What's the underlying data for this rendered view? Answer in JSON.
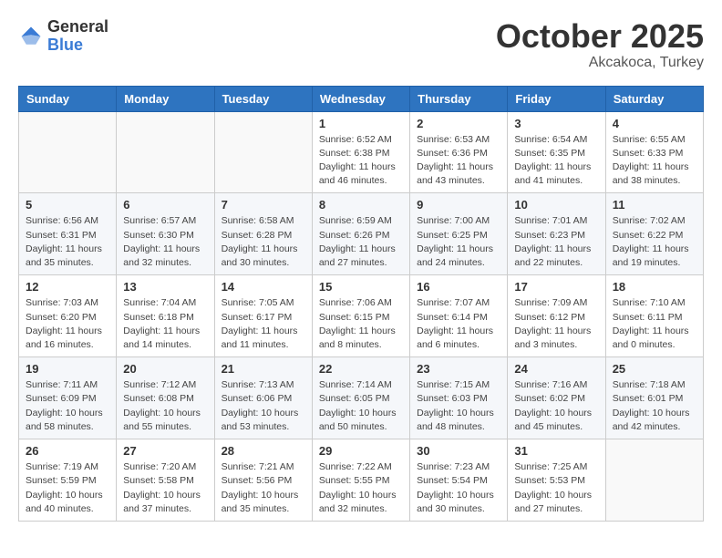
{
  "header": {
    "logo_general": "General",
    "logo_blue": "Blue",
    "month": "October 2025",
    "location": "Akcakoca, Turkey"
  },
  "weekdays": [
    "Sunday",
    "Monday",
    "Tuesday",
    "Wednesday",
    "Thursday",
    "Friday",
    "Saturday"
  ],
  "weeks": [
    [
      {
        "day": "",
        "info": ""
      },
      {
        "day": "",
        "info": ""
      },
      {
        "day": "",
        "info": ""
      },
      {
        "day": "1",
        "info": "Sunrise: 6:52 AM\nSunset: 6:38 PM\nDaylight: 11 hours and 46 minutes."
      },
      {
        "day": "2",
        "info": "Sunrise: 6:53 AM\nSunset: 6:36 PM\nDaylight: 11 hours and 43 minutes."
      },
      {
        "day": "3",
        "info": "Sunrise: 6:54 AM\nSunset: 6:35 PM\nDaylight: 11 hours and 41 minutes."
      },
      {
        "day": "4",
        "info": "Sunrise: 6:55 AM\nSunset: 6:33 PM\nDaylight: 11 hours and 38 minutes."
      }
    ],
    [
      {
        "day": "5",
        "info": "Sunrise: 6:56 AM\nSunset: 6:31 PM\nDaylight: 11 hours and 35 minutes."
      },
      {
        "day": "6",
        "info": "Sunrise: 6:57 AM\nSunset: 6:30 PM\nDaylight: 11 hours and 32 minutes."
      },
      {
        "day": "7",
        "info": "Sunrise: 6:58 AM\nSunset: 6:28 PM\nDaylight: 11 hours and 30 minutes."
      },
      {
        "day": "8",
        "info": "Sunrise: 6:59 AM\nSunset: 6:26 PM\nDaylight: 11 hours and 27 minutes."
      },
      {
        "day": "9",
        "info": "Sunrise: 7:00 AM\nSunset: 6:25 PM\nDaylight: 11 hours and 24 minutes."
      },
      {
        "day": "10",
        "info": "Sunrise: 7:01 AM\nSunset: 6:23 PM\nDaylight: 11 hours and 22 minutes."
      },
      {
        "day": "11",
        "info": "Sunrise: 7:02 AM\nSunset: 6:22 PM\nDaylight: 11 hours and 19 minutes."
      }
    ],
    [
      {
        "day": "12",
        "info": "Sunrise: 7:03 AM\nSunset: 6:20 PM\nDaylight: 11 hours and 16 minutes."
      },
      {
        "day": "13",
        "info": "Sunrise: 7:04 AM\nSunset: 6:18 PM\nDaylight: 11 hours and 14 minutes."
      },
      {
        "day": "14",
        "info": "Sunrise: 7:05 AM\nSunset: 6:17 PM\nDaylight: 11 hours and 11 minutes."
      },
      {
        "day": "15",
        "info": "Sunrise: 7:06 AM\nSunset: 6:15 PM\nDaylight: 11 hours and 8 minutes."
      },
      {
        "day": "16",
        "info": "Sunrise: 7:07 AM\nSunset: 6:14 PM\nDaylight: 11 hours and 6 minutes."
      },
      {
        "day": "17",
        "info": "Sunrise: 7:09 AM\nSunset: 6:12 PM\nDaylight: 11 hours and 3 minutes."
      },
      {
        "day": "18",
        "info": "Sunrise: 7:10 AM\nSunset: 6:11 PM\nDaylight: 11 hours and 0 minutes."
      }
    ],
    [
      {
        "day": "19",
        "info": "Sunrise: 7:11 AM\nSunset: 6:09 PM\nDaylight: 10 hours and 58 minutes."
      },
      {
        "day": "20",
        "info": "Sunrise: 7:12 AM\nSunset: 6:08 PM\nDaylight: 10 hours and 55 minutes."
      },
      {
        "day": "21",
        "info": "Sunrise: 7:13 AM\nSunset: 6:06 PM\nDaylight: 10 hours and 53 minutes."
      },
      {
        "day": "22",
        "info": "Sunrise: 7:14 AM\nSunset: 6:05 PM\nDaylight: 10 hours and 50 minutes."
      },
      {
        "day": "23",
        "info": "Sunrise: 7:15 AM\nSunset: 6:03 PM\nDaylight: 10 hours and 48 minutes."
      },
      {
        "day": "24",
        "info": "Sunrise: 7:16 AM\nSunset: 6:02 PM\nDaylight: 10 hours and 45 minutes."
      },
      {
        "day": "25",
        "info": "Sunrise: 7:18 AM\nSunset: 6:01 PM\nDaylight: 10 hours and 42 minutes."
      }
    ],
    [
      {
        "day": "26",
        "info": "Sunrise: 7:19 AM\nSunset: 5:59 PM\nDaylight: 10 hours and 40 minutes."
      },
      {
        "day": "27",
        "info": "Sunrise: 7:20 AM\nSunset: 5:58 PM\nDaylight: 10 hours and 37 minutes."
      },
      {
        "day": "28",
        "info": "Sunrise: 7:21 AM\nSunset: 5:56 PM\nDaylight: 10 hours and 35 minutes."
      },
      {
        "day": "29",
        "info": "Sunrise: 7:22 AM\nSunset: 5:55 PM\nDaylight: 10 hours and 32 minutes."
      },
      {
        "day": "30",
        "info": "Sunrise: 7:23 AM\nSunset: 5:54 PM\nDaylight: 10 hours and 30 minutes."
      },
      {
        "day": "31",
        "info": "Sunrise: 7:25 AM\nSunset: 5:53 PM\nDaylight: 10 hours and 27 minutes."
      },
      {
        "day": "",
        "info": ""
      }
    ]
  ]
}
